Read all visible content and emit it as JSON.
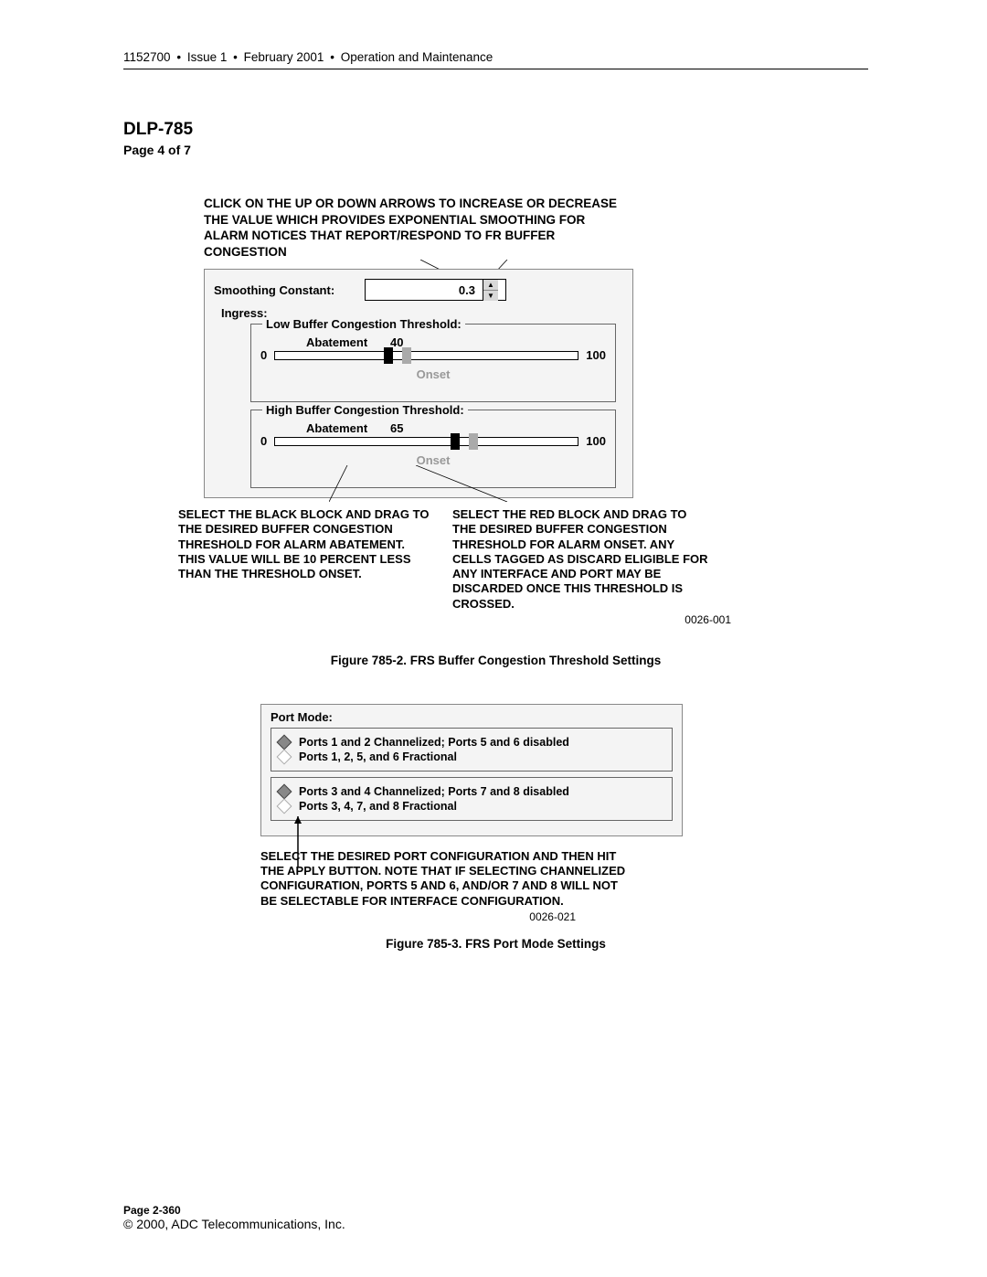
{
  "header": {
    "docnum": "1152700",
    "issue": "Issue 1",
    "date": "February 2001",
    "section": "Operation and Maintenance"
  },
  "title": "DLP-785",
  "subtitle": "Page 4 of 7",
  "annotation_top": "CLICK ON THE UP OR DOWN ARROWS TO INCREASE OR DECREASE THE VALUE WHICH PROVIDES EXPONENTIAL SMOOTHING FOR ALARM NOTICES THAT REPORT/RESPOND TO FR BUFFER CONGESTION",
  "smoothing": {
    "label": "Smoothing Constant:",
    "value": "0.3"
  },
  "ingress_label": "Ingress:",
  "threshold_low": {
    "title": "Low Buffer Congestion Threshold:",
    "abatement_label": "Abatement",
    "abatement_value": "40",
    "min": "0",
    "max": "100",
    "onset": "Onset"
  },
  "threshold_high": {
    "title": "High Buffer Congestion Threshold:",
    "abatement_label": "Abatement",
    "abatement_value": "65",
    "min": "0",
    "max": "100",
    "onset": "Onset"
  },
  "annotation_left": "SELECT THE BLACK BLOCK AND DRAG TO THE DESIRED BUFFER CONGESTION THRESHOLD FOR ALARM ABATEMENT. THIS VALUE WILL BE 10 PERCENT LESS THAN THE THRESHOLD ONSET.",
  "annotation_right": "SELECT THE RED BLOCK AND DRAG TO THE DESIRED BUFFER CONGESTION THRESHOLD FOR ALARM ONSET. ANY CELLS TAGGED AS DISCARD ELIGIBLE FOR ANY INTERFACE AND PORT MAY BE DISCARDED ONCE THIS THRESHOLD IS CROSSED.",
  "ref1": "0026-001",
  "caption1": "Figure 785-2. FRS Buffer Congestion Threshold Settings",
  "port_mode_label": "Port Mode:",
  "port_group1": {
    "opt1": "Ports 1 and 2 Channelized; Ports 5 and 6 disabled",
    "opt2": "Ports 1, 2, 5, and 6 Fractional"
  },
  "port_group2": {
    "opt1": "Ports 3 and 4 Channelized; Ports 7 and 8 disabled",
    "opt2": "Ports 3, 4, 7, and 8 Fractional"
  },
  "port_annotation": "SELECT THE DESIRED PORT CONFIGURATION AND THEN HIT THE APPLY BUTTON. NOTE THAT IF SELECTING CHANNELIZED CONFIGURATION, PORTS 5 AND 6, AND/OR 7 AND 8 WILL NOT BE SELECTABLE FOR INTERFACE CONFIGURATION.",
  "ref2": "0026-021",
  "caption2": "Figure 785-3. FRS Port Mode Settings",
  "footer": {
    "page": "Page 2-360",
    "copy": "© 2000, ADC Telecommunications, Inc."
  }
}
